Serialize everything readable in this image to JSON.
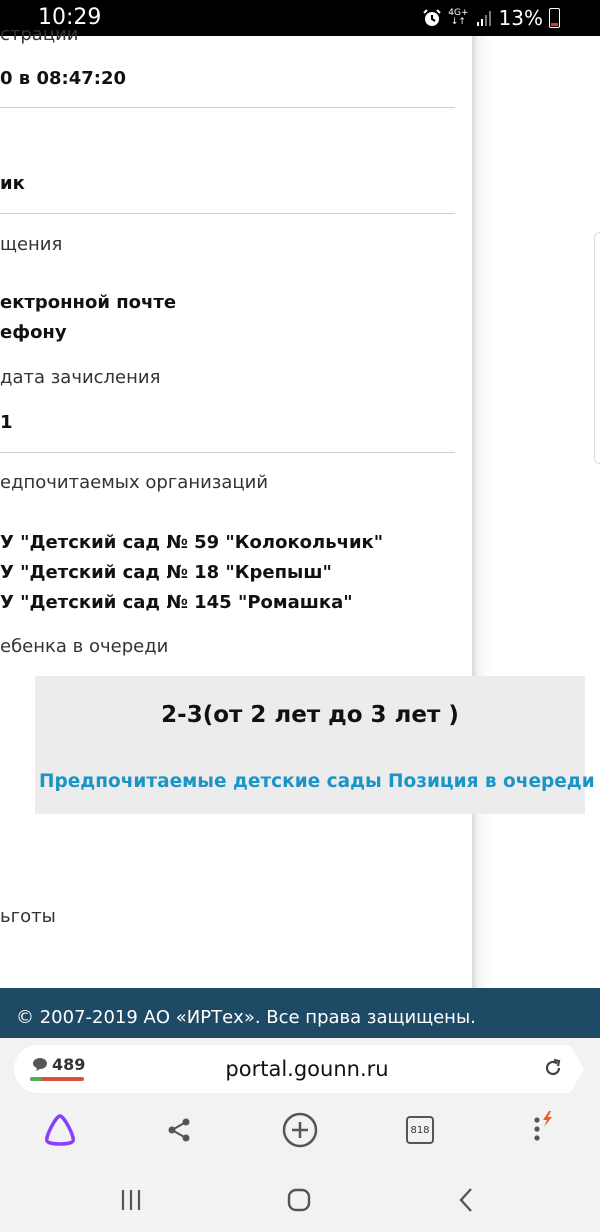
{
  "status_bar": {
    "time": "10:29",
    "network": "4G+",
    "battery": "13%"
  },
  "content": {
    "registration_label": "страции",
    "registration_value": "0 в 08:47:20",
    "row2_value": "ик",
    "notify_label": "щения",
    "notify_value_1": "ектронной почте",
    "notify_value_2": "ефону",
    "enroll_label": "дата зачисления",
    "enroll_value": "1",
    "orgs_label": "едпочитаемых организаций",
    "orgs": [
      "У \"Детский сад № 59 \"Колокольчик\"",
      "У \"Детский сад № 18 \"Крепыш\"",
      "У \"Детский сад № 145 \"Ромашка\""
    ],
    "queue_label": "ебенка в очереди",
    "benefits_label": "ьготы"
  },
  "popup": {
    "title": "2-3(от 2 лет до 3 лет )",
    "link_preferred": "Предпочитаемые детские сады",
    "link_position": "Позиция в очереди"
  },
  "footer": {
    "copyright": "© 2007-2019 АО «ИРТех». Все права защищены."
  },
  "browser": {
    "comments_count": "489",
    "url": "portal.gounn.ru",
    "tabs_count": "818",
    "icons": [
      "alice-icon",
      "share-icon",
      "plus-icon",
      "tabs-icon",
      "menu-icon"
    ]
  },
  "colors": {
    "footer_bg": "#1e4a66",
    "link": "#1b95c6",
    "alice": "#8a3ffc",
    "popup_bg": "#ececec"
  }
}
